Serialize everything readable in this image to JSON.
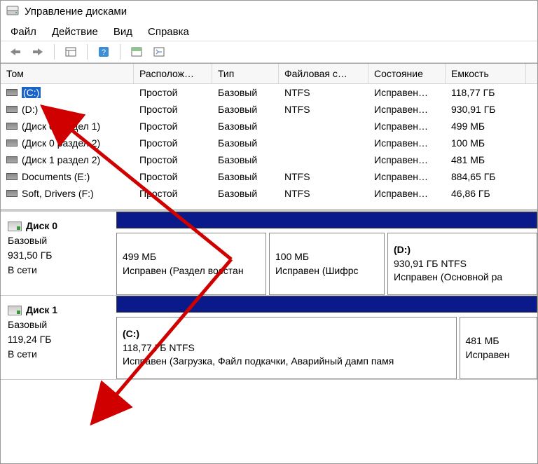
{
  "title": "Управление дисками",
  "menu": {
    "file": "Файл",
    "action": "Действие",
    "view": "Вид",
    "help": "Справка"
  },
  "columns": {
    "volume": "Том",
    "layout": "Располож…",
    "type": "Тип",
    "fs": "Файловая с…",
    "status": "Состояние",
    "capacity": "Емкость"
  },
  "volumes": [
    {
      "name": "(C:)",
      "layout": "Простой",
      "type": "Базовый",
      "fs": "NTFS",
      "status": "Исправен…",
      "capacity": "118,77 ГБ",
      "selected": true
    },
    {
      "name": "(D:)",
      "layout": "Простой",
      "type": "Базовый",
      "fs": "NTFS",
      "status": "Исправен…",
      "capacity": "930,91 ГБ"
    },
    {
      "name": "(Диск 0 раздел 1)",
      "layout": "Простой",
      "type": "Базовый",
      "fs": "",
      "status": "Исправен…",
      "capacity": "499 МБ"
    },
    {
      "name": "(Диск 0 раздел 2)",
      "layout": "Простой",
      "type": "Базовый",
      "fs": "",
      "status": "Исправен…",
      "capacity": "100 МБ"
    },
    {
      "name": "(Диск 1 раздел 2)",
      "layout": "Простой",
      "type": "Базовый",
      "fs": "",
      "status": "Исправен…",
      "capacity": "481 МБ"
    },
    {
      "name": "Documents (E:)",
      "layout": "Простой",
      "type": "Базовый",
      "fs": "NTFS",
      "status": "Исправен…",
      "capacity": "884,65 ГБ"
    },
    {
      "name": "Soft, Drivers (F:)",
      "layout": "Простой",
      "type": "Базовый",
      "fs": "NTFS",
      "status": "Исправен…",
      "capacity": "46,86 ГБ"
    }
  ],
  "disks": [
    {
      "title": "Диск 0",
      "type": "Базовый",
      "size": "931,50 ГБ",
      "online": "В сети",
      "partitions": [
        {
          "name": "",
          "size": "499 МБ",
          "status": "Исправен (Раздел восстан",
          "flex": 2
        },
        {
          "name": "",
          "size": "100 МБ",
          "status": "Исправен (Шифрс",
          "flex": 1.5
        },
        {
          "name": "(D:)",
          "size": "930,91 ГБ NTFS",
          "status": "Исправен (Основной ра",
          "flex": 2
        }
      ]
    },
    {
      "title": "Диск 1",
      "type": "Базовый",
      "size": "119,24 ГБ",
      "online": "В сети",
      "partitions": [
        {
          "name": "(C:)",
          "size": "118,77 ГБ NTFS",
          "status": "Исправен (Загрузка, Файл подкачки, Аварийный дамп памя",
          "flex": 5
        },
        {
          "name": "",
          "size": "481 МБ",
          "status": "Исправен",
          "flex": 1
        }
      ]
    }
  ]
}
